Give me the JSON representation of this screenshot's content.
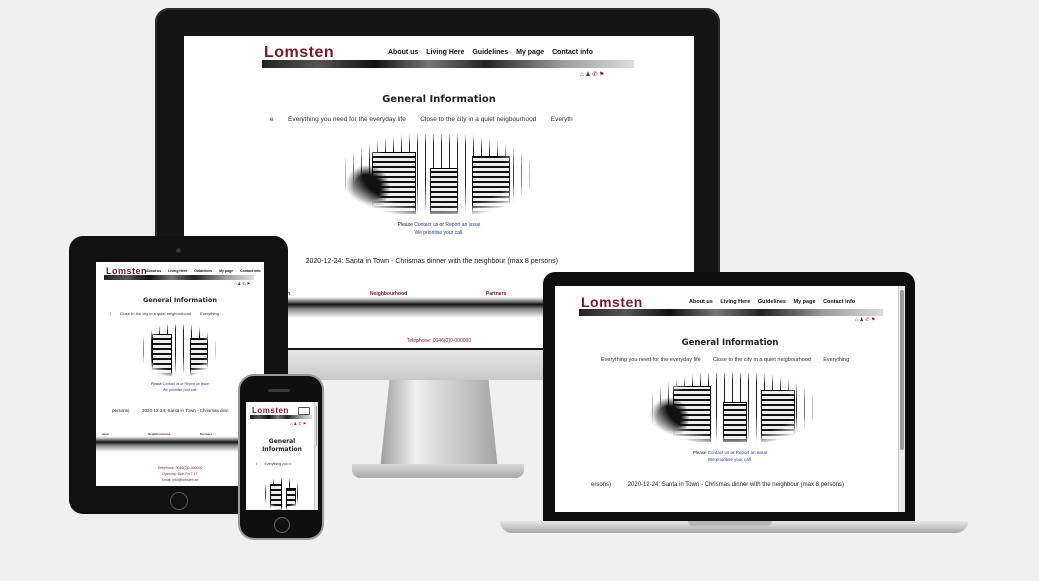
{
  "site": {
    "logo": "Lomsten",
    "nav": [
      "About us",
      "Living Here",
      "Guidelines",
      "My page",
      "Contact info"
    ],
    "nav_short": [
      "About us",
      "Living Here",
      "Guidelines",
      "My page",
      "Contact info"
    ],
    "icons": "⌂ ♟ ✆ ⚑",
    "heading": "General Information",
    "phone_heading_line1": "General",
    "phone_heading_line2": "Information",
    "marquee_desktop": "e        Everything you need for the everyday life        Close to the city in a quiet neigbourhood        Everyth",
    "marquee_laptop": "Everything you need for the everyday life        Close to the city in a quiet neigbourhood        Everything",
    "marquee_tablet": "l        Close to the city in a quiet neigbourhood        Everything",
    "marquee_phone": "l        Everything you n",
    "notice_prefix": "Please ",
    "notice_link1": "Contact us",
    "notice_mid": " or ",
    "notice_link2": "Report an issue",
    "notice_line2": "We prioritise your call.",
    "news_desktop": "rs)          2020-12-24: Santa in Town - Chrismas dinner with the neighbour (max 8 persons)",
    "news_laptop": "ersons)          2020-12-24: Santa in Town - Chrismas dinner with the neighbour (max 8 persons)",
    "news_tablet": "persons)          2020-12-24: Santa in Town - Chrismas dinn",
    "footer_labels": [
      "ation",
      "Neighbourhood",
      "Partners"
    ],
    "footer_phone": "Telephone: 0046(0)0-000000",
    "footer_extra": [
      "Opening: Mon-Fri 7-17",
      "Email: info@lomsten.se"
    ]
  },
  "colors": {
    "brand": "#7a1a25",
    "link": "#2a3aa8",
    "background": "#f0f0f0"
  }
}
